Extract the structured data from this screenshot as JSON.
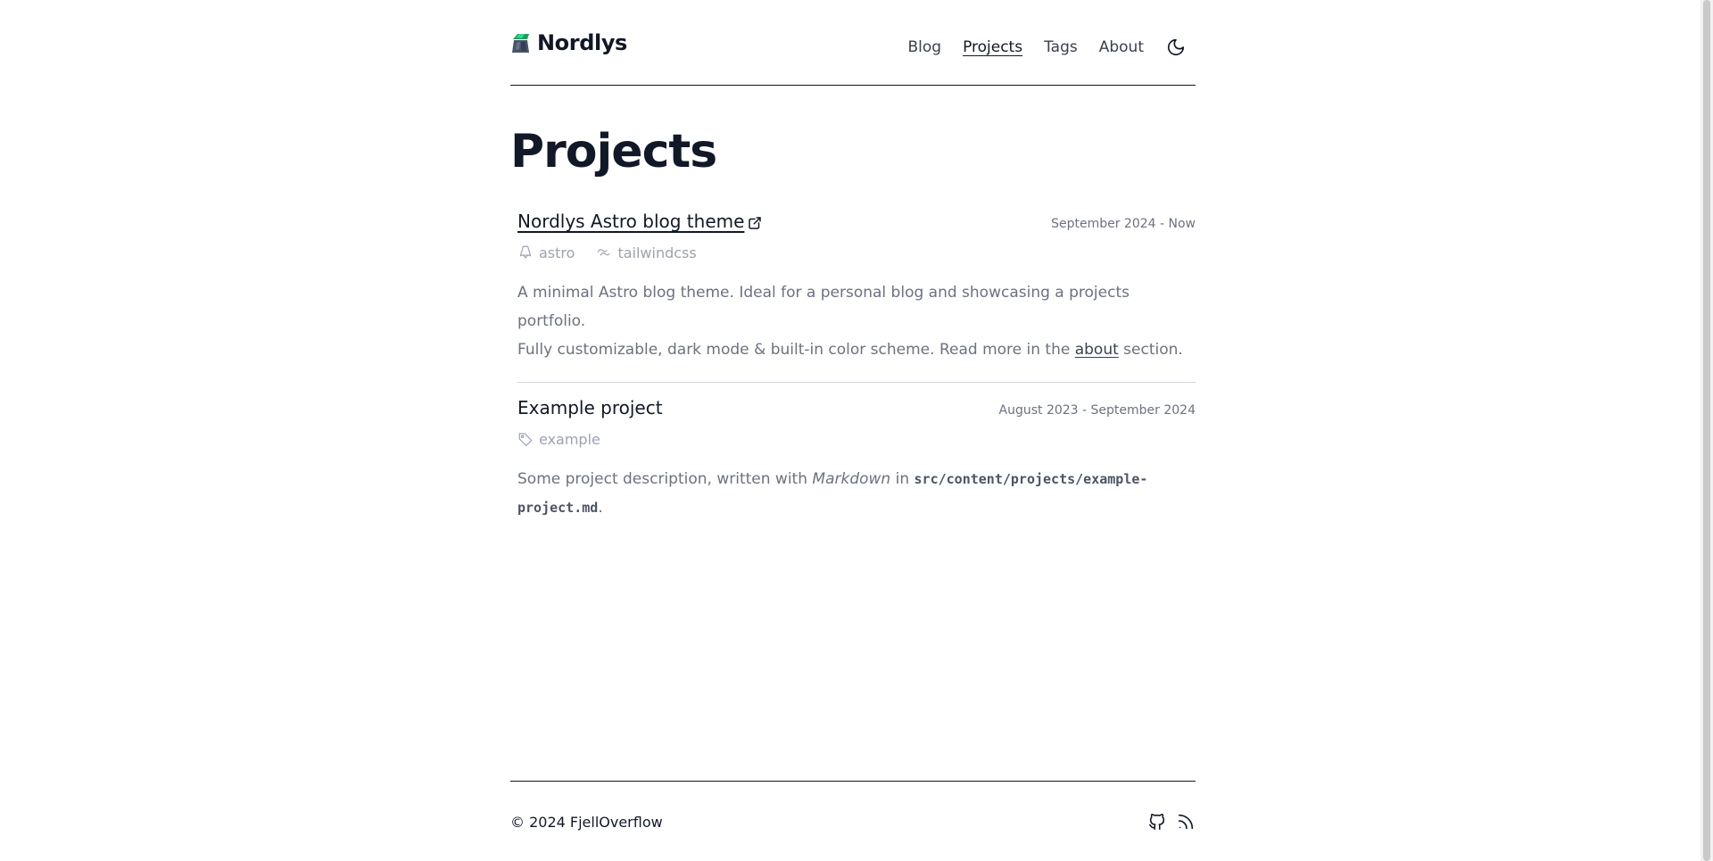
{
  "brand": {
    "name": "Nordlys"
  },
  "nav": {
    "blog": "Blog",
    "projects": "Projects",
    "tags": "Tags",
    "about": "About"
  },
  "page": {
    "title": "Projects"
  },
  "projects": [
    {
      "title": "Nordlys Astro blog theme",
      "date": "September 2024 - Now",
      "tags": [
        {
          "label": "astro",
          "icon": "astro-icon"
        },
        {
          "label": "tailwindcss",
          "icon": "tailwind-icon"
        }
      ],
      "desc_line1": "A minimal Astro blog theme. Ideal for a personal blog and showcasing a projects portfolio.",
      "desc_pre": "Fully customizable, dark mode & built-in color scheme. Read more in the ",
      "desc_link": "about",
      "desc_post": " section."
    },
    {
      "title": "Example project",
      "date": "August 2023 - September 2024",
      "tags": [
        {
          "label": "example",
          "icon": "tag-icon"
        }
      ],
      "desc_pre": "Some project description, written with ",
      "desc_em": "Markdown",
      "desc_mid": " in ",
      "desc_code": "src/content/projects/example-project.md",
      "desc_post": "."
    }
  ],
  "footer": {
    "copyright": "© 2024 FjellOverflow"
  },
  "colors": {
    "text": "#111827",
    "muted": "#6b7280",
    "faint": "#9ca3af",
    "logo_green": "#1f9d55",
    "logo_slate": "#475569"
  }
}
